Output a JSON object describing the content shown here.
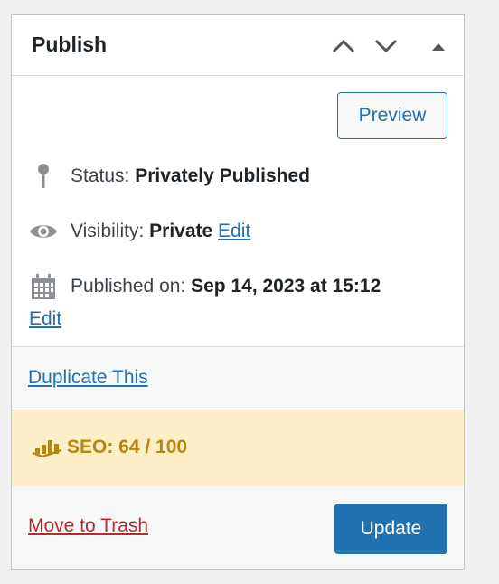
{
  "header": {
    "title": "Publish"
  },
  "actions": {
    "preview_label": "Preview"
  },
  "status": {
    "label": "Status:",
    "value": "Privately Published"
  },
  "visibility": {
    "label": "Visibility:",
    "value": "Private",
    "edit_label": "Edit"
  },
  "published": {
    "label": "Published on:",
    "value": "Sep 14, 2023 at 15:12",
    "edit_label": "Edit"
  },
  "duplicate": {
    "label": "Duplicate This"
  },
  "seo": {
    "label": "SEO: 64 / 100",
    "color": "#b8860b"
  },
  "footer": {
    "trash_label": "Move to Trash",
    "update_label": "Update"
  },
  "icons": {
    "up": "chevron-up-icon",
    "down": "chevron-down-icon",
    "toggle": "triangle-up-icon",
    "status": "pin-icon",
    "visibility": "eye-icon",
    "calendar": "calendar-icon",
    "seo": "seo-chart-icon"
  },
  "colors": {
    "accent": "#2271b1",
    "danger": "#b32d2e",
    "seo_bg": "#fcefc7"
  }
}
